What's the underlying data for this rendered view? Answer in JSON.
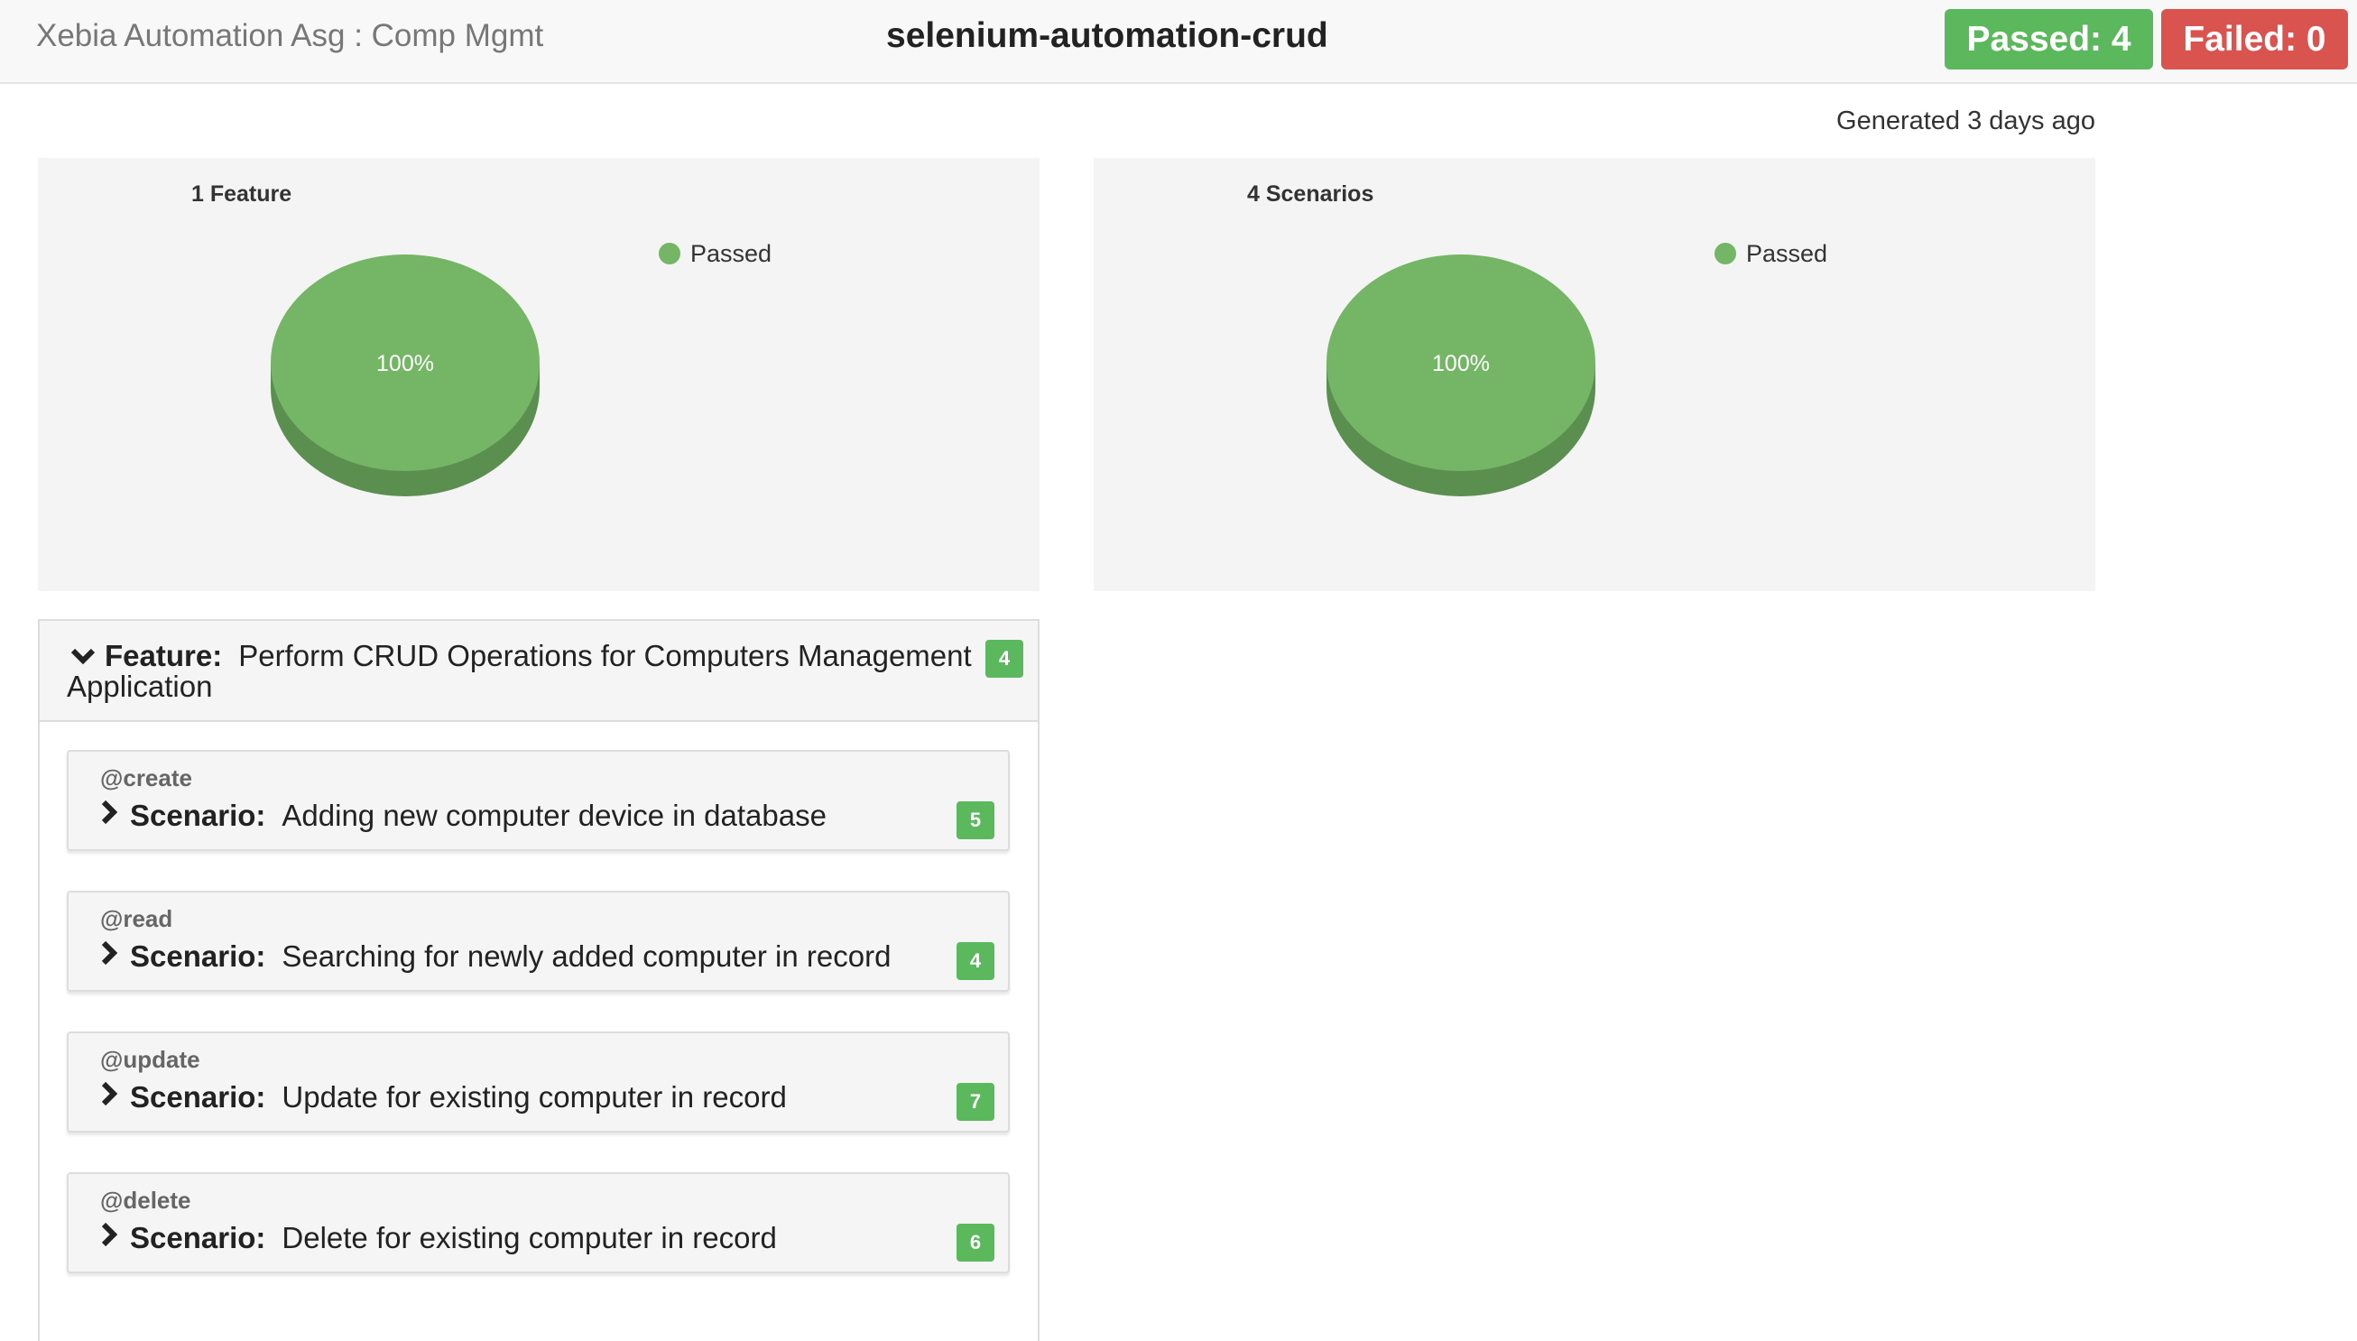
{
  "header": {
    "app_title": "Xebia Automation Asg : Comp Mgmt",
    "report_title": "selenium-automation-crud",
    "passed_label": "Passed: 4",
    "failed_label": "Failed: 0"
  },
  "generated": "Generated 3 days ago",
  "colors": {
    "passed": "#5cb85c",
    "failed": "#d9534f",
    "pie_top": "#74b566",
    "pie_side": "#5a8f50"
  },
  "chart_data": [
    {
      "type": "pie",
      "title": "1 Feature",
      "slices": [
        {
          "label": "Passed",
          "value": 1,
          "percent_label": "100%"
        }
      ],
      "legend": "top-right"
    },
    {
      "type": "pie",
      "title": "4 Scenarios",
      "slices": [
        {
          "label": "Passed",
          "value": 4,
          "percent_label": "100%"
        }
      ],
      "legend": "top-right"
    }
  ],
  "feature": {
    "keyword": "Feature:",
    "name": "Perform CRUD Operations for Computers Management Application",
    "count": "4",
    "icon": "chevron-down-icon",
    "scenarios": [
      {
        "tag": "@create",
        "keyword": "Scenario:",
        "name": "Adding new computer device in database",
        "count": "5",
        "icon": "chevron-right-icon"
      },
      {
        "tag": "@read",
        "keyword": "Scenario:",
        "name": "Searching for newly added computer in record",
        "count": "4",
        "icon": "chevron-right-icon"
      },
      {
        "tag": "@update",
        "keyword": "Scenario:",
        "name": "Update for existing computer in record",
        "count": "7",
        "icon": "chevron-right-icon"
      },
      {
        "tag": "@delete",
        "keyword": "Scenario:",
        "name": "Delete for existing computer in record",
        "count": "6",
        "icon": "chevron-right-icon"
      }
    ]
  }
}
